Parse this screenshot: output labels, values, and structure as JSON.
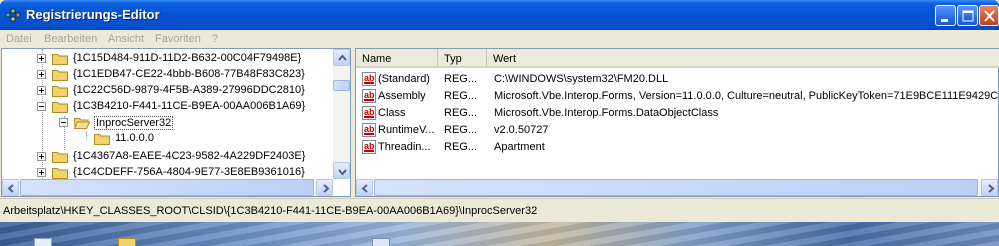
{
  "window": {
    "title": "Registrierungs-Editor"
  },
  "menu": [
    "Datei",
    "Bearbeiten",
    "Ansicht",
    "Favoriten",
    "?"
  ],
  "tree": [
    {
      "label": "{1C15D484-911D-11D2-B632-00C04F79498E}",
      "expander": "plus"
    },
    {
      "label": "{1C1EDB47-CE22-4bbb-B608-77B48F83C823}",
      "expander": "plus"
    },
    {
      "label": "{1C22C56D-9879-4F5B-A389-27996DDC2810}",
      "expander": "plus"
    },
    {
      "label": "{1C3B4210-F441-11CE-B9EA-00AA006B1A69}",
      "expander": "minus"
    },
    {
      "label": "InprocServer32",
      "expander": "minus"
    },
    {
      "label": "11.0.0.0",
      "expander": "none"
    },
    {
      "label": "{1C4367A8-EAEE-4C23-9582-4A229DF2403E}",
      "expander": "plus"
    },
    {
      "label": "{1C4CDEFF-756A-4804-9E77-3E8EB9361016}",
      "expander": "plus"
    }
  ],
  "columns": {
    "name": "Name",
    "type": "Typ",
    "value": "Wert"
  },
  "values": [
    {
      "name": "(Standard)",
      "type": "REG...",
      "value": "C:\\WINDOWS\\system32\\FM20.DLL"
    },
    {
      "name": "Assembly",
      "type": "REG...",
      "value": "Microsoft.Vbe.Interop.Forms, Version=11.0.0.0, Culture=neutral, PublicKeyToken=71E9BCE111E9429C"
    },
    {
      "name": "Class",
      "type": "REG...",
      "value": "Microsoft.Vbe.Interop.Forms.DataObjectClass"
    },
    {
      "name": "RuntimeV...",
      "type": "REG...",
      "value": "v2.0.50727"
    },
    {
      "name": "Threadin...",
      "type": "REG...",
      "value": "Apartment"
    }
  ],
  "status": {
    "path": "Arbeitsplatz\\HKEY_CLASSES_ROOT\\CLSID\\{1C3B4210-F441-11CE-B9EA-00AA006B1A69}\\InprocServer32"
  },
  "icons": {
    "app": "registry-editor-icon",
    "folder": "folder-icon",
    "value": "string-value-icon"
  },
  "colors": {
    "titlebar": "#0653d4",
    "selection_border": "#555555",
    "folder": "#f2d36a"
  }
}
